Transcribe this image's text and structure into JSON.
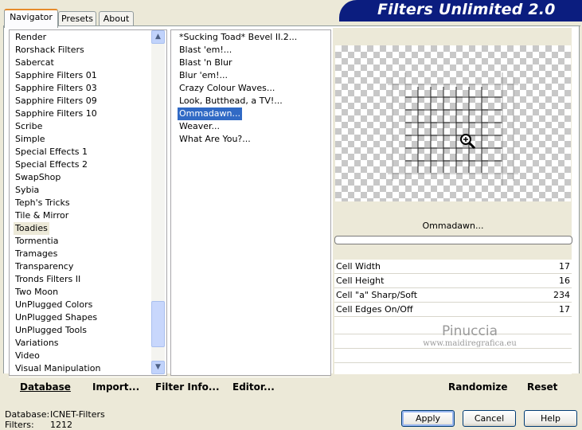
{
  "app": {
    "title": "Filters Unlimited 2.0"
  },
  "tabs": [
    {
      "label": "Navigator",
      "active": true
    },
    {
      "label": "Presets",
      "active": false
    },
    {
      "label": "About",
      "active": false
    }
  ],
  "categories": {
    "items": [
      "Render",
      "Rorshack Filters",
      "Sabercat",
      "Sapphire Filters 01",
      "Sapphire Filters 03",
      "Sapphire Filters 09",
      "Sapphire Filters 10",
      "Scribe",
      "Simple",
      "Special Effects 1",
      "Special Effects 2",
      "SwapShop",
      "Sybia",
      "Teph's Tricks",
      "Tile & Mirror",
      "Toadies",
      "Tormentia",
      "Tramages",
      "Transparency",
      "Tronds Filters II",
      "Two Moon",
      "UnPlugged Colors",
      "UnPlugged Shapes",
      "UnPlugged Tools",
      "Variations",
      "Video",
      "Visual Manipulation"
    ],
    "selected": "Toadies"
  },
  "filters": {
    "items": [
      "*Sucking Toad*  Bevel II.2...",
      "Blast 'em!...",
      "Blast 'n Blur",
      "Blur 'em!...",
      "Crazy Colour Waves...",
      "Look, Butthead, a TV!...",
      "Ommadawn...",
      "Weaver...",
      "What Are You?..."
    ],
    "selected": "Ommadawn..."
  },
  "preview": {
    "filter_name": "Ommadawn...",
    "zoom_icon": "magnifier-icon"
  },
  "params": [
    {
      "label": "Cell Width",
      "value": "17"
    },
    {
      "label": "Cell Height",
      "value": "16"
    },
    {
      "label": "Cell \"a\" Sharp/Soft",
      "value": "234"
    },
    {
      "label": "Cell Edges On/Off",
      "value": "17"
    }
  ],
  "watermark": {
    "name": "Pinuccia",
    "url": "www.maidiregrafica.eu"
  },
  "toolbar": {
    "database": "Database",
    "import": "Import...",
    "filter_info": "Filter Info...",
    "editor": "Editor...",
    "randomize": "Randomize",
    "reset": "Reset"
  },
  "status": {
    "database_label": "Database:",
    "database_value": "ICNET-Filters",
    "filters_label": "Filters:",
    "filters_value": "1212"
  },
  "buttons": {
    "apply": "Apply",
    "cancel": "Cancel",
    "help": "Help"
  },
  "colors": {
    "banner": "#0b1d7f",
    "selection": "#316ac5",
    "dialog_bg": "#ece9d8"
  }
}
